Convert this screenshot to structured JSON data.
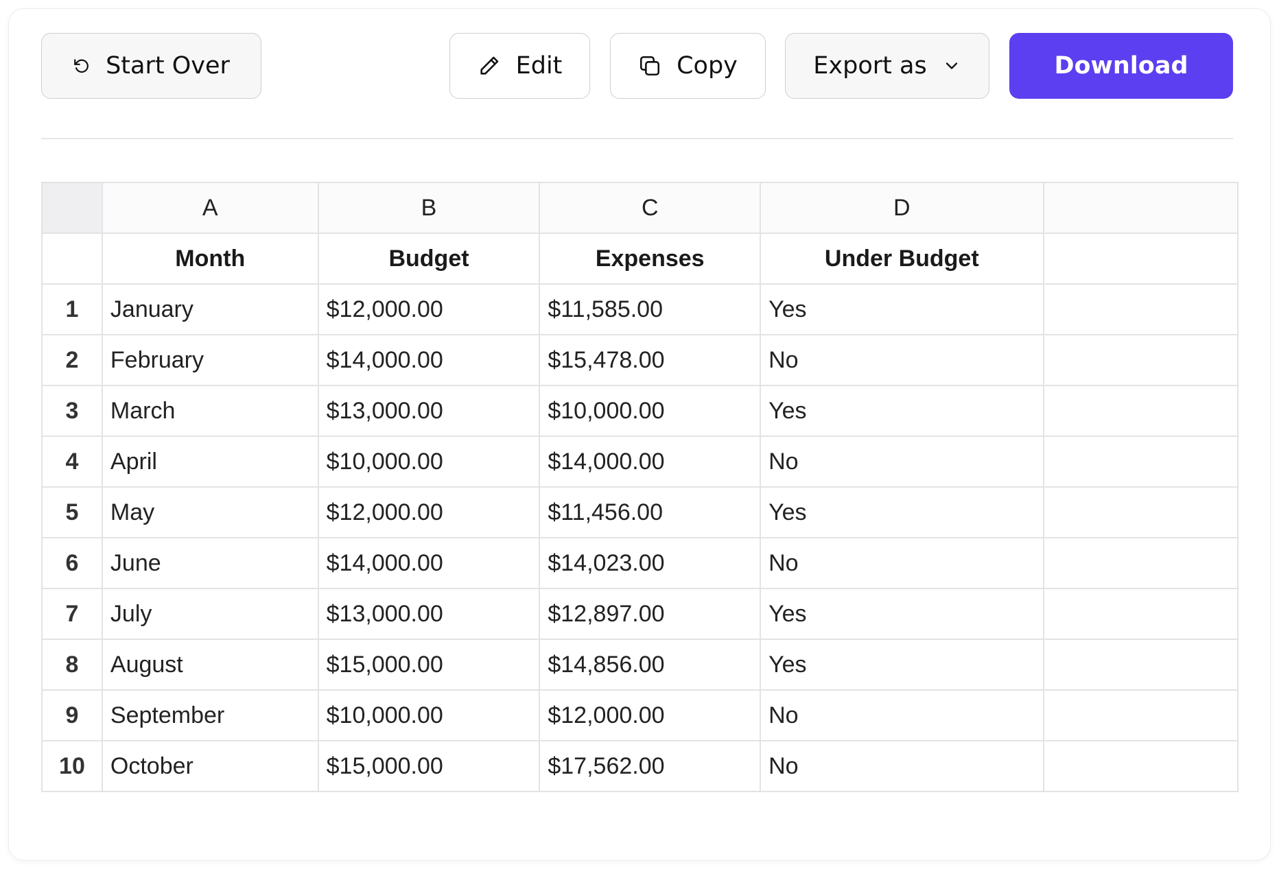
{
  "toolbar": {
    "start_over_label": "Start Over",
    "start_over_icon": "rotate-ccw-icon",
    "edit_label": "Edit",
    "edit_icon": "pencil-icon",
    "copy_label": "Copy",
    "copy_icon": "copy-icon",
    "export_label": "Export as",
    "export_icon": "chevron-down-icon",
    "download_label": "Download",
    "download_color": "#5b3ff0"
  },
  "sheet": {
    "column_letters": [
      "A",
      "B",
      "C",
      "D"
    ],
    "headers": [
      "Month",
      "Budget",
      "Expenses",
      "Under Budget"
    ],
    "rows": [
      {
        "num": "1",
        "month": "January",
        "budget": "$12,000.00",
        "expenses": "$11,585.00",
        "under": "Yes"
      },
      {
        "num": "2",
        "month": "February",
        "budget": "$14,000.00",
        "expenses": "$15,478.00",
        "under": "No"
      },
      {
        "num": "3",
        "month": "March",
        "budget": "$13,000.00",
        "expenses": "$10,000.00",
        "under": "Yes"
      },
      {
        "num": "4",
        "month": "April",
        "budget": "$10,000.00",
        "expenses": "$14,000.00",
        "under": "No"
      },
      {
        "num": "5",
        "month": "May",
        "budget": "$12,000.00",
        "expenses": "$11,456.00",
        "under": "Yes"
      },
      {
        "num": "6",
        "month": "June",
        "budget": "$14,000.00",
        "expenses": "$14,023.00",
        "under": "No"
      },
      {
        "num": "7",
        "month": "July",
        "budget": "$13,000.00",
        "expenses": "$12,897.00",
        "under": "Yes"
      },
      {
        "num": "8",
        "month": "August",
        "budget": "$15,000.00",
        "expenses": "$14,856.00",
        "under": "Yes"
      },
      {
        "num": "9",
        "month": "September",
        "budget": "$10,000.00",
        "expenses": "$12,000.00",
        "under": "No"
      },
      {
        "num": "10",
        "month": "October",
        "budget": "$15,000.00",
        "expenses": "$17,562.00",
        "under": "No"
      }
    ]
  }
}
